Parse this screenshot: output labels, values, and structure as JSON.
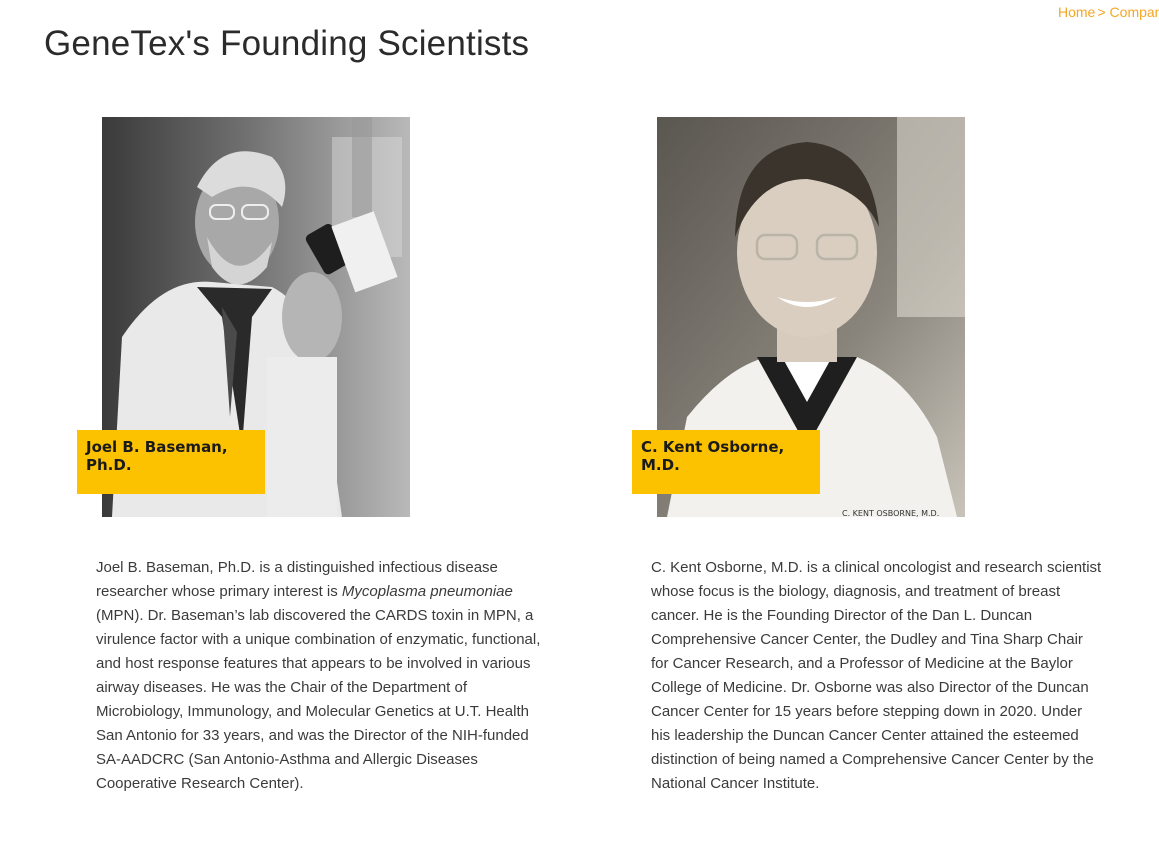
{
  "breadcrumb": {
    "home": "Home",
    "separator": ">",
    "current": "Company"
  },
  "page_title": "GeneTex's Founding Scientists",
  "scientists": [
    {
      "name": "Joel B. Baseman, Ph.D.",
      "bio_before_italic": "Joel B. Baseman, Ph.D. is a distinguished infectious disease researcher whose primary interest is ",
      "bio_italic": "Mycoplasma pneumoniae",
      "bio_after_italic": " (MPN). Dr. Baseman’s lab discovered the CARDS toxin in MPN, a virulence factor with a unique combination of enzymatic, functional, and host response features that appears to be involved in various airway diseases. He was the Chair of the Department of Microbiology, Immunology, and Molecular Genetics at U.T. Health San Antonio for 33 years, and was the Director of the NIH-funded SA-AADCRC (San Antonio-Asthma and Allergic Diseases Cooperative Research Center)."
    },
    {
      "name": "C. Kent Osborne, M.D.",
      "coat_label": "C. KENT OSBORNE, M.D.",
      "bio": "C. Kent Osborne, M.D. is a clinical oncologist and research scientist whose focus is the biology, diagnosis, and treatment of breast cancer. He is the Founding Director of the Dan L. Duncan Comprehensive Cancer Center, the Dudley and Tina Sharp Chair for Cancer Research, and a Professor of Medicine at the Baylor College of Medicine. Dr. Osborne was also Director of the Duncan Cancer Center for 15 years before stepping down in 2020. Under his leadership the Duncan Cancer Center attained the esteemed distinction of being named a Comprehensive Cancer Center by the National Cancer Institute."
    }
  ],
  "colors": {
    "accent": "#fcc200",
    "breadcrumb": "#f5a623",
    "title": "#2b2b2b",
    "body_text": "#3b3b3b"
  }
}
